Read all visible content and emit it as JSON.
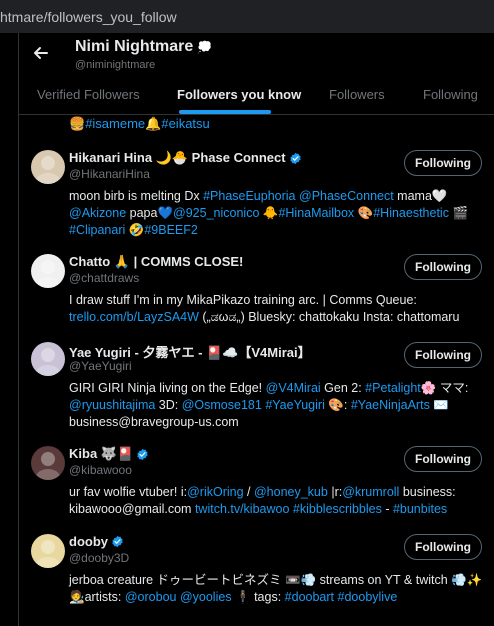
{
  "browser": {
    "url_prefix": "htmare/followers_you_follow"
  },
  "header": {
    "name": "Nimi Nightmare",
    "name_emoji": "💭",
    "handle": "@niminightmare"
  },
  "tabs": [
    {
      "label": "Verified Followers"
    },
    {
      "label": "Followers you know"
    },
    {
      "label": "Followers"
    },
    {
      "label": "Following"
    }
  ],
  "partial_row": {
    "parts": [
      {
        "t": "🍔 ",
        "link": false
      },
      {
        "t": "#isameme",
        "link": true
      },
      {
        "t": " 🔔 ",
        "link": false
      },
      {
        "t": "#eikatsu",
        "link": true
      }
    ]
  },
  "users": [
    {
      "name": "Hikanari Hina 🌙🐣 Phase Connect",
      "verified": true,
      "handle": "@HikanariHina",
      "button": "Following",
      "avatar_color": "#d8c8b0",
      "bio": [
        {
          "t": "moon birb is melting Dx ",
          "link": false
        },
        {
          "t": "#PhaseEuphoria",
          "link": true
        },
        {
          "t": " ",
          "link": false
        },
        {
          "t": "@PhaseConnect",
          "link": true
        },
        {
          "t": " mama🤍 ",
          "link": false
        },
        {
          "t": "@Akizone",
          "link": true
        },
        {
          "t": " papa💙",
          "link": false
        },
        {
          "t": "@925_niconico",
          "link": true
        },
        {
          "t": " 🐥",
          "link": false
        },
        {
          "t": "#HinaMailbox",
          "link": true
        },
        {
          "t": " 🎨",
          "link": false
        },
        {
          "t": "#Hinaesthetic",
          "link": true
        },
        {
          "t": " 🎬 ",
          "link": false
        },
        {
          "t": "#Clipanari",
          "link": true
        },
        {
          "t": " 🤣",
          "link": false
        },
        {
          "t": "#9BEEF2",
          "link": true
        }
      ]
    },
    {
      "name": "Chatto 🙏 | COMMS CLOSE!",
      "verified": false,
      "handle": "@chattdraws",
      "button": "Following",
      "avatar_color": "#f0f0f0",
      "bio": [
        {
          "t": "I draw stuff I'm in my MikaPikazo training arc. | Comms Queue: ",
          "link": false
        },
        {
          "t": "trello.com/b/LayzSA4W",
          "link": true
        },
        {
          "t": " („ಡωಡ„) Bluesky: chattokaku Insta: chattomaru",
          "link": false
        }
      ]
    },
    {
      "name": "Yae Yugiri - 夕霧ヤエ - 🎴☁️【V4Mirai】",
      "verified": false,
      "handle": "@YaeYugiri",
      "button": "Following",
      "avatar_color": "#c9c2d6",
      "bio": [
        {
          "t": "GIRI GIRI Ninja living on the Edge! ",
          "link": false
        },
        {
          "t": "@V4Mirai",
          "link": true
        },
        {
          "t": " Gen 2: ",
          "link": false
        },
        {
          "t": "#Petalight",
          "link": true
        },
        {
          "t": "🌸 ママ: ",
          "link": false
        },
        {
          "t": "@ryuushitajima",
          "link": true
        },
        {
          "t": " 3D: ",
          "link": false
        },
        {
          "t": "@Osmose181",
          "link": true
        },
        {
          "t": " ",
          "link": false
        },
        {
          "t": "#YaeYugiri",
          "link": true
        },
        {
          "t": " 🎨: ",
          "link": false
        },
        {
          "t": "#YaeNinjaArts",
          "link": true
        },
        {
          "t": " ✉️ business@bravegroup-us.com",
          "link": false
        }
      ]
    },
    {
      "name": "Kiba 🐺🎴",
      "verified": true,
      "handle": "@kibawooo",
      "button": "Following",
      "avatar_color": "#5a3a3a",
      "bio": [
        {
          "t": "ur fav wolfie vtuber! i:",
          "link": false
        },
        {
          "t": "@rikOring",
          "link": true
        },
        {
          "t": " / ",
          "link": false
        },
        {
          "t": "@honey_kub",
          "link": true
        },
        {
          "t": " |r:",
          "link": false
        },
        {
          "t": "@krumroll",
          "link": true
        },
        {
          "t": " business: kibawooo@gmail.com ",
          "link": false
        },
        {
          "t": "twitch.tv/kibawoo",
          "link": true
        },
        {
          "t": " ",
          "link": false
        },
        {
          "t": "#kibblescribbles",
          "link": true
        },
        {
          "t": " - ",
          "link": false
        },
        {
          "t": "#bunbites",
          "link": true
        }
      ]
    },
    {
      "name": "dooby",
      "verified": true,
      "handle": "@dooby3D",
      "button": "Following",
      "avatar_color": "#e8d8a0",
      "bio": [
        {
          "t": "jerboa creature ドゥービートビネズミ 📼💨 streams on YT & twitch 💨✨ 🧑‍🎨artists: ",
          "link": false
        },
        {
          "t": "@orobou",
          "link": true
        },
        {
          "t": " ",
          "link": false
        },
        {
          "t": "@yoolies",
          "link": true
        },
        {
          "t": " 🕴 tags: ",
          "link": false
        },
        {
          "t": "#doobart",
          "link": true
        },
        {
          "t": " ",
          "link": false
        },
        {
          "t": "#doobylive",
          "link": true
        }
      ]
    }
  ]
}
